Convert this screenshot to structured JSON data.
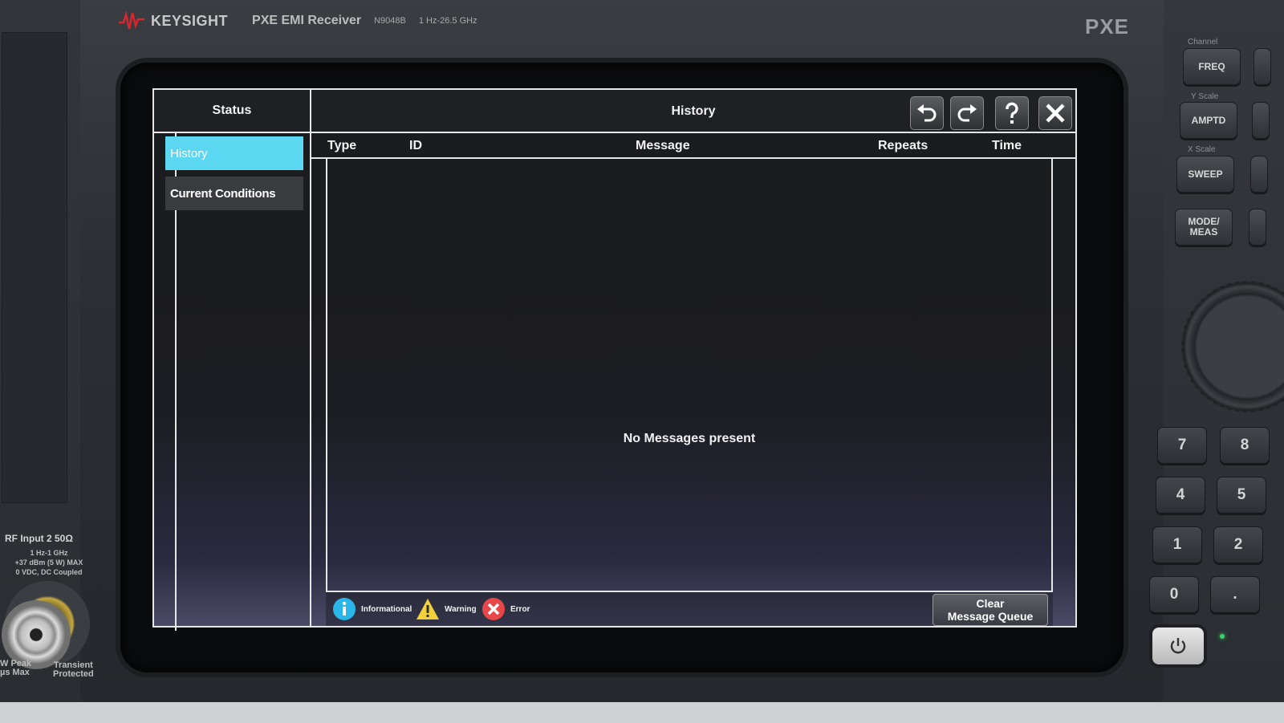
{
  "instrument": {
    "brand": "KEYSIGHT",
    "model": "PXE EMI Receiver",
    "model_number": "N9048B",
    "freq_range": "1 Hz-26.5 GHz",
    "series_badge": "PXE"
  },
  "front_panel": {
    "rf_input": {
      "label": "RF Input 2 50Ω",
      "spec_line1": "1 Hz-1 GHz",
      "spec_line2": "+37 dBm (5 W) MAX",
      "spec_line3": "0 VDC, DC Coupled",
      "peak_line1": "W Peak",
      "peak_line2": "µs Max",
      "transient_line1": "Transient",
      "transient_line2": "Protected"
    },
    "groups": {
      "channel": "Channel",
      "y_scale": "Y Scale",
      "x_scale": "X Scale"
    },
    "keys": {
      "freq": "FREQ",
      "amptd": "AMPTD",
      "sweep": "SWEEP",
      "mode_meas_1": "MODE/",
      "mode_meas_2": "MEAS"
    },
    "numpad": [
      "7",
      "8",
      "4",
      "5",
      "1",
      "2",
      "0",
      "."
    ],
    "power_icon": "power-icon",
    "led_color": "#3ad06a"
  },
  "status_panel": {
    "title": "Status",
    "items": [
      {
        "label": "History",
        "selected": true
      },
      {
        "label": "Current Conditions",
        "selected": false
      }
    ],
    "selected_color": "#5cd7f2"
  },
  "history_panel": {
    "title": "History",
    "toolbar": {
      "undo_icon": "undo-icon",
      "redo_icon": "redo-icon",
      "help_icon": "help-icon",
      "close_icon": "close-icon"
    },
    "columns": [
      "Type",
      "ID",
      "Message",
      "Repeats",
      "Time"
    ],
    "rows": [],
    "empty_message": "No Messages present",
    "legend": [
      {
        "icon": "info-icon",
        "label": "Informational",
        "color": "#2ab6e8"
      },
      {
        "icon": "warning-icon",
        "label": "Warning",
        "color": "#f2d13a"
      },
      {
        "icon": "error-icon",
        "label": "Error",
        "color": "#e8474a"
      }
    ],
    "clear_button": {
      "line1": "Clear",
      "line2": "Message Queue"
    }
  }
}
